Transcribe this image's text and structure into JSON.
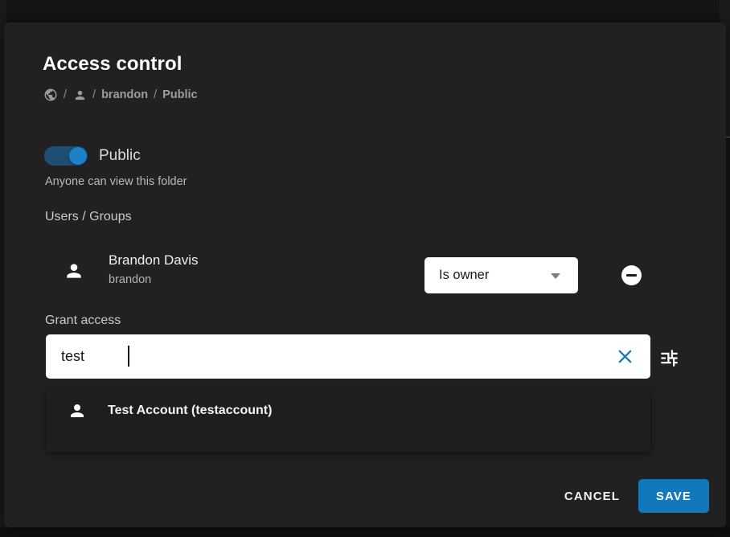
{
  "dialog": {
    "title": "Access control",
    "breadcrumb": {
      "globe_icon": "globe-icon",
      "person_icon": "person-icon",
      "separator": "/",
      "items": [
        {
          "label": "brandon"
        },
        {
          "label": "Public"
        }
      ]
    },
    "public_toggle": {
      "label": "Public",
      "state": "on",
      "help_text": "Anyone can view this folder",
      "track_color": "#1c4f73",
      "knob_color": "#1d81c9"
    },
    "users_groups": {
      "section_label": "Users / Groups",
      "rows": [
        {
          "avatar_icon": "person-icon",
          "name": "Brandon Davis",
          "handle": "brandon",
          "role": "Is owner",
          "role_caret_icon": "chevron-down-icon",
          "remove_icon": "minus-circle-icon"
        }
      ]
    },
    "grant_access": {
      "label": "Grant access",
      "search_value": "test",
      "search_placeholder": "",
      "clear_icon": "close-icon",
      "clear_icon_color": "#1579bd",
      "tune_icon": "tune-icon",
      "suggestions": [
        {
          "avatar_icon": "person-icon",
          "label": "Test Account (testaccount)"
        }
      ]
    },
    "footer": {
      "cancel_label": "CANCEL",
      "save_label": "SAVE",
      "save_color": "#1178ba"
    }
  }
}
